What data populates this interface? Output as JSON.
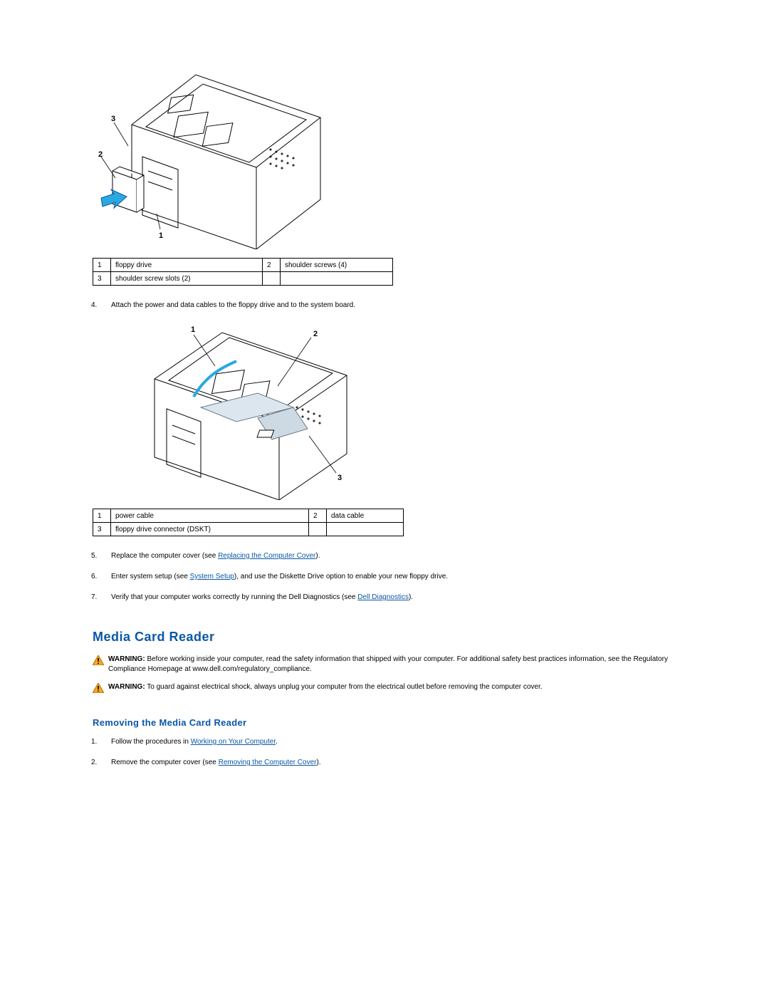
{
  "figure1": {
    "callouts": {
      "c1": "1",
      "c2": "2",
      "c3": "3"
    },
    "legend": {
      "r1n": "1",
      "r1v": "floppy drive",
      "r2n": "2",
      "r2v": "shoulder screws (4)",
      "r3n": "3",
      "r3v": "shoulder screw slots (2)",
      "r4n": "",
      "r4v": ""
    }
  },
  "steps_a": {
    "s4": {
      "num": "4.",
      "text": "Attach the power and data cables to the floppy drive and to the system board."
    }
  },
  "figure2": {
    "callouts": {
      "c1": "1",
      "c2": "2",
      "c3": "3"
    },
    "legend": {
      "r1n": "1",
      "r1v": "power cable",
      "r2n": "2",
      "r2v": "data cable",
      "r3n": "3",
      "r3v": "floppy drive connector (DSKT)",
      "r4n": "",
      "r4v": ""
    }
  },
  "steps_b": {
    "s5": {
      "num": "5.",
      "pre": "Replace the computer cover (see ",
      "link": "Replacing the Computer Cover",
      "post": ")."
    },
    "s6": {
      "num": "6.",
      "pre": "Enter system setup (see ",
      "link": "System Setup",
      "post": "), and use the Diskette Drive option to enable your new floppy drive."
    },
    "s7": {
      "num": "7.",
      "pre": "Verify that your computer works correctly by running the Dell Diagnostics (see ",
      "link": "Dell Diagnostics",
      "post": ")."
    }
  },
  "section": {
    "title": "Media Card Reader",
    "warn1": {
      "label": "WARNING:",
      "text": " Before working inside your computer, read the safety information that shipped with your computer. For additional safety best practices information, see the Regulatory Compliance Homepage at www.dell.com/regulatory_compliance."
    },
    "warn2": {
      "label": "WARNING:",
      "text": " To guard against electrical shock, always unplug your computer from the electrical outlet before removing the computer cover."
    },
    "sub": "Removing the Media Card Reader"
  },
  "steps_c": {
    "s1": {
      "num": "1.",
      "pre": "Follow the procedures in ",
      "link": "Working on Your Computer",
      "post": "."
    },
    "s2": {
      "num": "2.",
      "pre": "Remove the computer cover (see ",
      "link": "Removing the Computer Cover",
      "post": ")."
    }
  }
}
